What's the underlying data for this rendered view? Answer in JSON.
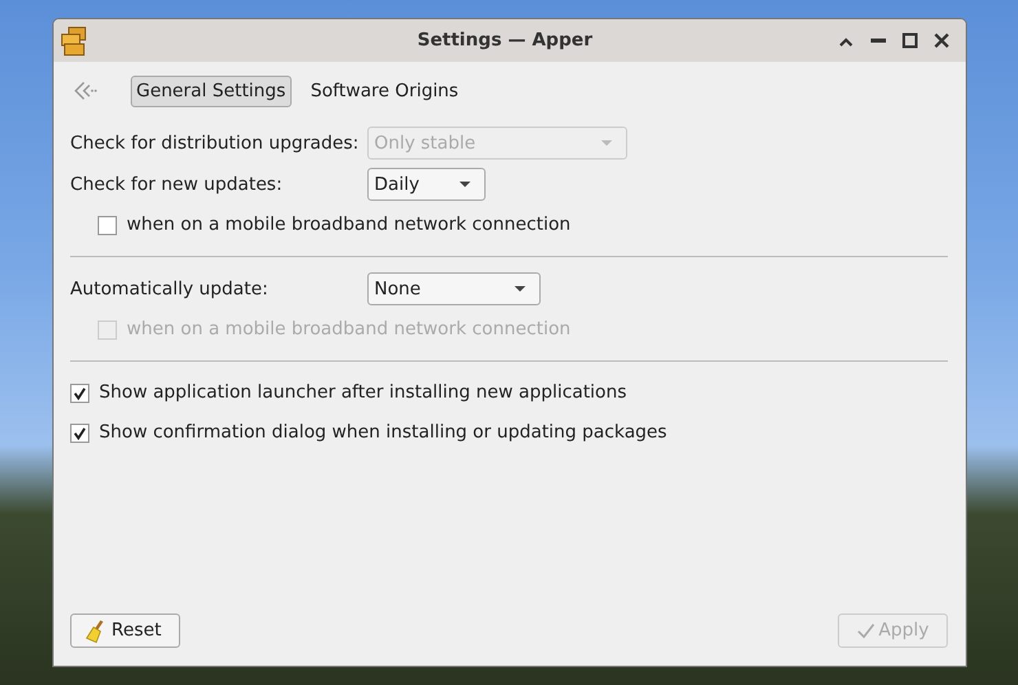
{
  "window": {
    "title": "Settings — Apper"
  },
  "toolbar": {
    "tabs": [
      {
        "label": "General Settings",
        "selected": true
      },
      {
        "label": "Software Origins",
        "selected": false
      }
    ]
  },
  "settings": [
    {
      "kind": "combo",
      "label": "Check for distribution upgrades:",
      "value": "Only stable",
      "disabled": true
    },
    {
      "kind": "combo",
      "label": "Check for new updates:",
      "value": "Daily",
      "disabled": false
    },
    {
      "kind": "subcheck",
      "label": "when on a mobile broadband network connection",
      "checked": false,
      "disabled": false
    },
    {
      "kind": "separator"
    },
    {
      "kind": "combo",
      "label": "Automatically update:",
      "value": "None",
      "disabled": false
    },
    {
      "kind": "subcheck",
      "label": "when on a mobile broadband network connection",
      "checked": false,
      "disabled": true
    },
    {
      "kind": "separator"
    },
    {
      "kind": "check",
      "label": "Show application launcher after installing new applications",
      "checked": true,
      "disabled": false
    },
    {
      "kind": "check",
      "label": "Show confirmation dialog when installing or updating packages",
      "checked": true,
      "disabled": false
    }
  ],
  "buttons": [
    {
      "kind": "reset",
      "label": "Reset",
      "disabled": false
    },
    {
      "kind": "apply",
      "label": "Apply",
      "disabled": true
    }
  ]
}
